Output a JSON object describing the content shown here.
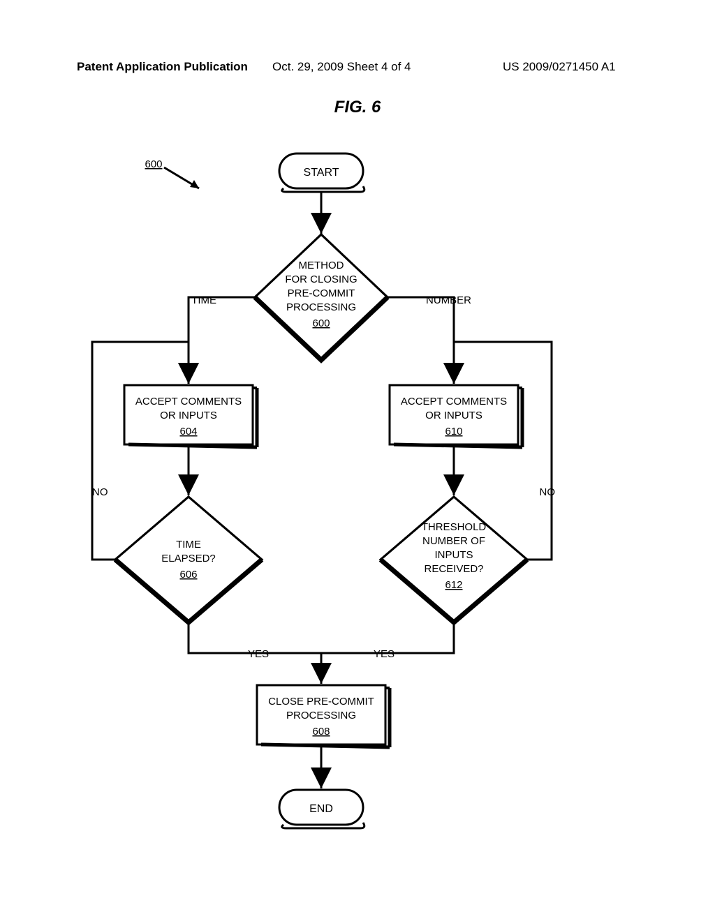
{
  "header": {
    "left": "Patent Application Publication",
    "center": "Oct. 29, 2009  Sheet 4 of 4",
    "right": "US 2009/0271450 A1"
  },
  "figure_title": "FIG. 6",
  "flowchart_ref": "600",
  "nodes": {
    "start": "START",
    "decision1": {
      "line1": "METHOD",
      "line2": "FOR CLOSING",
      "line3": "PRE-COMMIT",
      "line4": "PROCESSING",
      "ref": "600"
    },
    "process_left": {
      "line1": "ACCEPT COMMENTS",
      "line2": "OR INPUTS",
      "ref": "604"
    },
    "process_right": {
      "line1": "ACCEPT COMMENTS",
      "line2": "OR INPUTS",
      "ref": "610"
    },
    "decision_left": {
      "line1": "TIME",
      "line2": "ELAPSED?",
      "ref": "606"
    },
    "decision_right": {
      "line1": "THRESHOLD",
      "line2": "NUMBER OF",
      "line3": "INPUTS",
      "line4": "RECEIVED?",
      "ref": "612"
    },
    "close": {
      "line1": "CLOSE PRE-COMMIT",
      "line2": "PROCESSING",
      "ref": "608"
    },
    "end": "END"
  },
  "labels": {
    "time": "TIME",
    "number": "NUMBER",
    "yes": "YES",
    "no": "NO"
  }
}
